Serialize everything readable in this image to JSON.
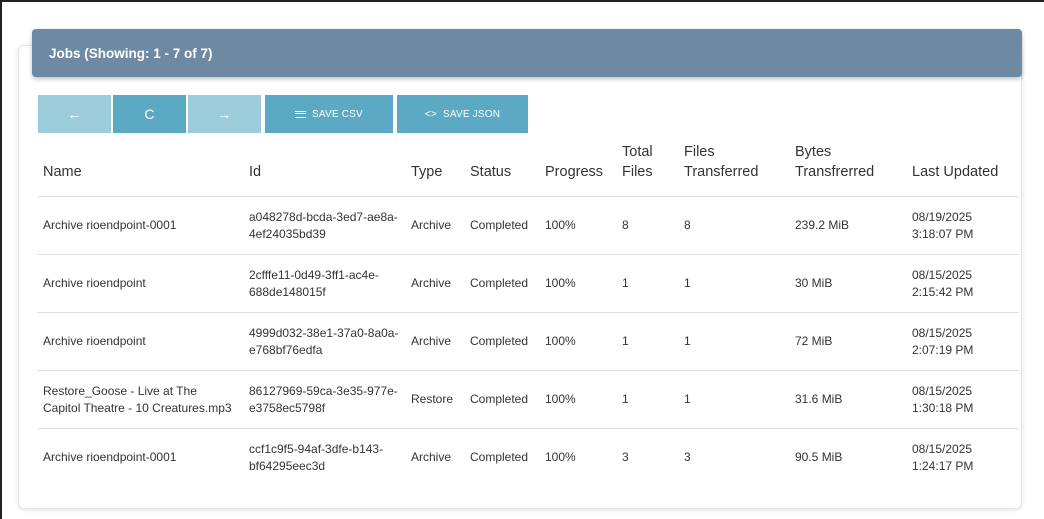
{
  "header": {
    "title": "Jobs (Showing: 1 - 7 of 7)"
  },
  "toolbar": {
    "back_icon": "←",
    "refresh_icon": "C",
    "forward_icon": "→",
    "save_csv_label": "SAVE CSV",
    "save_json_label": "SAVE JSON",
    "save_json_icon": "<>"
  },
  "table": {
    "columns": [
      "Name",
      "Id",
      "Type",
      "Status",
      "Progress",
      "Total Files",
      "Files Transferred",
      "Bytes Transfrerred",
      "Last Updated"
    ],
    "rows": [
      {
        "name": "Archive rioendpoint-0001",
        "id": "a048278d-bcda-3ed7-ae8a-4ef24035bd39",
        "type": "Archive",
        "status": "Completed",
        "progress": "100%",
        "total_files": "8",
        "files_transferred": "8",
        "bytes": "239.2 MiB",
        "updated_date": "08/19/2025",
        "updated_time": "3:18:07 PM"
      },
      {
        "name": "Archive rioendpoint",
        "id": "2cfffe11-0d49-3ff1-ac4e-688de148015f",
        "type": "Archive",
        "status": "Completed",
        "progress": "100%",
        "total_files": "1",
        "files_transferred": "1",
        "bytes": "30 MiB",
        "updated_date": "08/15/2025",
        "updated_time": "2:15:42 PM"
      },
      {
        "name": "Archive rioendpoint",
        "id": "4999d032-38e1-37a0-8a0a-e768bf76edfa",
        "type": "Archive",
        "status": "Completed",
        "progress": "100%",
        "total_files": "1",
        "files_transferred": "1",
        "bytes": "72 MiB",
        "updated_date": "08/15/2025",
        "updated_time": "2:07:19 PM"
      },
      {
        "name": "Restore_Goose - Live at The Capitol Theatre - 10 Creatures.mp3",
        "id": "86127969-59ca-3e35-977e-e3758ec5798f",
        "type": "Restore",
        "status": "Completed",
        "progress": "100%",
        "total_files": "1",
        "files_transferred": "1",
        "bytes": "31.6 MiB",
        "updated_date": "08/15/2025",
        "updated_time": "1:30:18 PM"
      },
      {
        "name": "Archive rioendpoint-0001",
        "id": "ccf1c9f5-94af-3dfe-b143-bf64295eec3d",
        "type": "Archive",
        "status": "Completed",
        "progress": "100%",
        "total_files": "3",
        "files_transferred": "3",
        "bytes": "90.5 MiB",
        "updated_date": "08/15/2025",
        "updated_time": "1:24:17 PM"
      }
    ]
  }
}
